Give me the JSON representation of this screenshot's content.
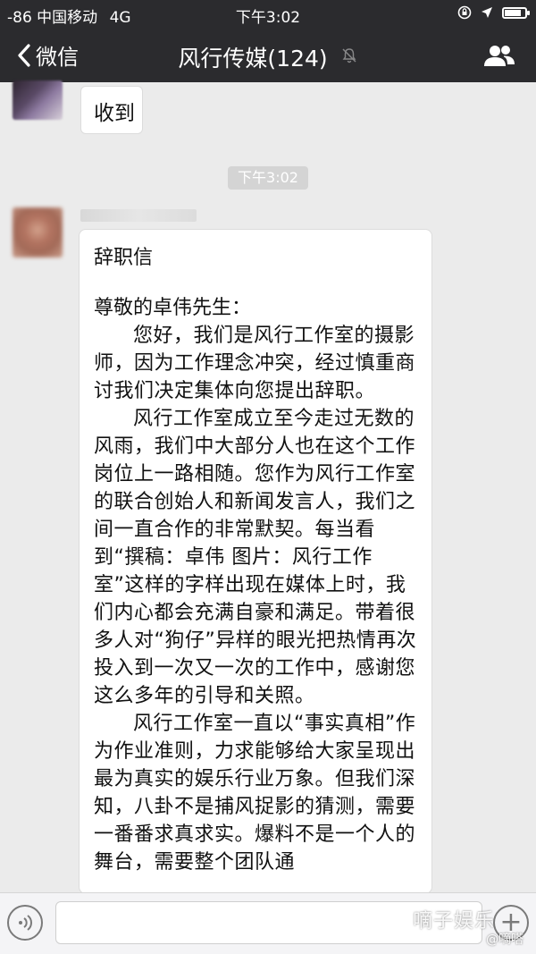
{
  "status_bar": {
    "carrier": "-86 中国移动",
    "network": "4G",
    "time": "下午3:02",
    "battery_level": 0.9
  },
  "nav": {
    "back_label": "微信",
    "title": "风行传媒(124)",
    "mute_icon": "bell-muted-icon",
    "group_icon": "group-members-icon"
  },
  "messages": {
    "prev_message": "收到",
    "time_divider": "下午3:02",
    "letter": {
      "title": "辞职信",
      "salutation": "尊敬的卓伟先生：",
      "paragraphs": [
        "您好，我们是风行工作室的摄影师，因为工作理念冲突，经过慎重商讨我们决定集体向您提出辞职。",
        "风行工作室成立至今走过无数的风雨，我们中大部分人也在这个工作岗位上一路相随。您作为风行工作室的联合创始人和新闻发言人，我们之间一直合作的非常默契。每当看到“撰稿：卓伟 图片：风行工作室”这样的字样出现在媒体上时，我们内心都会充满自豪和满足。带着很多人对“狗仔”异样的眼光把热情再次投入到一次又一次的工作中，感谢您这么多年的引导和关照。",
        "风行工作室一直以“事实真相”作为作业准则，力求能够给大家呈现出最为真实的娱乐行业万象。但我们深知，八卦不是捕风捉影的猜测，需要一番番求真求实。爆料不是一个人的舞台，需要整个团队通"
      ]
    }
  },
  "input_bar": {
    "voice_icon": "voice-icon",
    "plus_icon": "plus-circle-icon"
  },
  "watermark": {
    "brand": "嘀子娱乐",
    "handle": "@嘀嗒"
  },
  "colors": {
    "header_bg": "#2b2b2e",
    "chat_bg": "#ebebeb",
    "bubble_bg": "#ffffff"
  }
}
